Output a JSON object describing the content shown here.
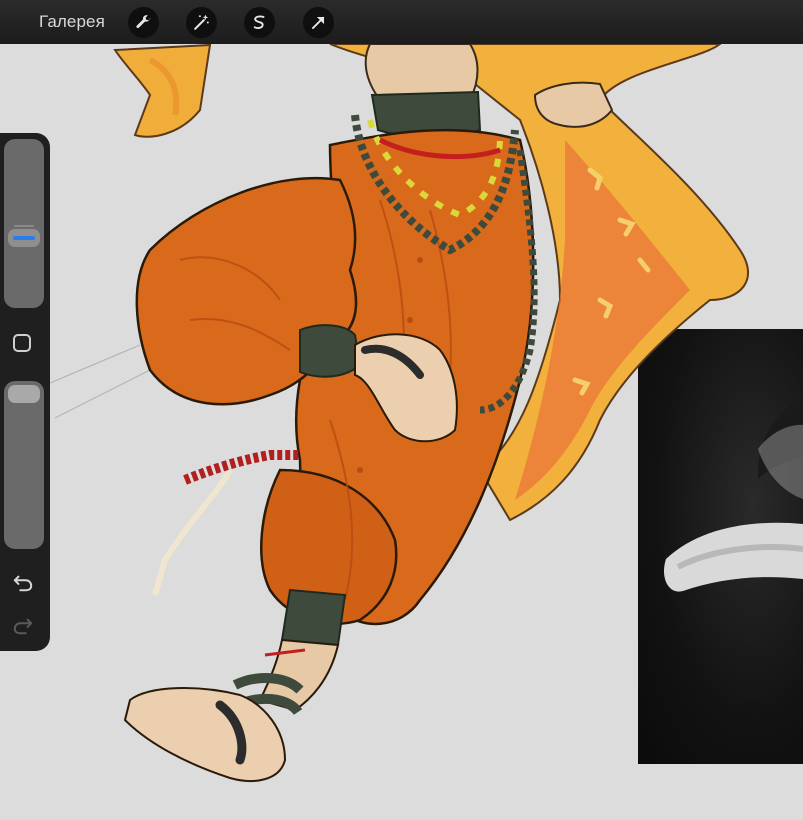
{
  "app": {
    "gallery_label": "Галерея"
  },
  "toolbar": {
    "tools": [
      {
        "name": "wrench-icon",
        "semantic": "actions"
      },
      {
        "name": "magic-wand-icon",
        "semantic": "adjustments"
      },
      {
        "name": "selection-icon",
        "semantic": "selection"
      },
      {
        "name": "transform-arrow-icon",
        "semantic": "transform"
      }
    ]
  },
  "sidebar": {
    "brush_size_level": 0.55,
    "opacity_level": 1.0,
    "modify_icon": "square-icon",
    "undo_icon": "undo-icon",
    "redo_icon": "redo-icon"
  },
  "colors": {
    "toolbar_bg": "#1c1c1c",
    "canvas_bg": "#dcdcdc",
    "accent": "#2b7de9",
    "pants_orange": "#d96a1c",
    "scarf_yellow": "#f0b43a",
    "skin": "#e8c9a6",
    "band_dark": "#3e4a3c"
  }
}
